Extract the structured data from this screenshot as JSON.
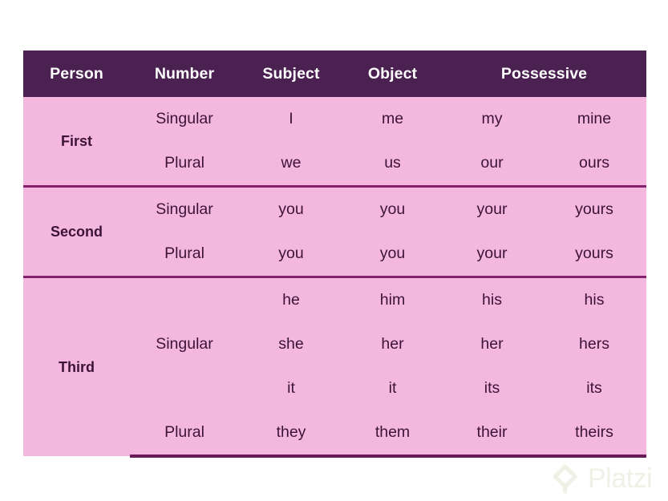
{
  "table": {
    "headers": [
      {
        "label": "Person",
        "colspan": 1
      },
      {
        "label": "Number",
        "colspan": 1
      },
      {
        "label": "Subject",
        "colspan": 1
      },
      {
        "label": "Object",
        "colspan": 1
      },
      {
        "label": "Possessive",
        "colspan": 2
      }
    ],
    "header_labels": {
      "person": "Person",
      "number": "Number",
      "subject": "Subject",
      "object": "Object",
      "possessive": "Possessive"
    },
    "groups": [
      {
        "person": "First",
        "rows": [
          {
            "number": "Singular",
            "subject": "I",
            "object": "me",
            "possessive_adj": "my",
            "possessive_pron": "mine"
          },
          {
            "number": "Plural",
            "subject": "we",
            "object": "us",
            "possessive_adj": "our",
            "possessive_pron": "ours"
          }
        ]
      },
      {
        "person": "Second",
        "rows": [
          {
            "number": "Singular",
            "subject": "you",
            "object": "you",
            "possessive_adj": "your",
            "possessive_pron": "yours"
          },
          {
            "number": "Plural",
            "subject": "you",
            "object": "you",
            "possessive_adj": "your",
            "possessive_pron": "yours"
          }
        ]
      },
      {
        "person": "Third",
        "rows": [
          {
            "number": "",
            "subject": "he",
            "object": "him",
            "possessive_adj": "his",
            "possessive_pron": "his"
          },
          {
            "number": "Singular",
            "subject": "she",
            "object": "her",
            "possessive_adj": "her",
            "possessive_pron": "hers"
          },
          {
            "number": "",
            "subject": "it",
            "object": "it",
            "possessive_adj": "its",
            "possessive_pron": "its"
          },
          {
            "number": "Plural",
            "subject": "they",
            "object": "them",
            "possessive_adj": "their",
            "possessive_pron": "theirs"
          }
        ]
      }
    ]
  },
  "watermark": {
    "text": "Platzi",
    "icon": "platzi-logo-icon"
  },
  "colors": {
    "header_bg": "#4a2150",
    "header_text": "#ffffff",
    "body_bg": "#f4b8df",
    "body_text": "#3c1336",
    "divider": "#86216f",
    "bottom_border": "#6a1a58",
    "page_bg": "#ffffff",
    "watermark": "#eff0e6"
  }
}
